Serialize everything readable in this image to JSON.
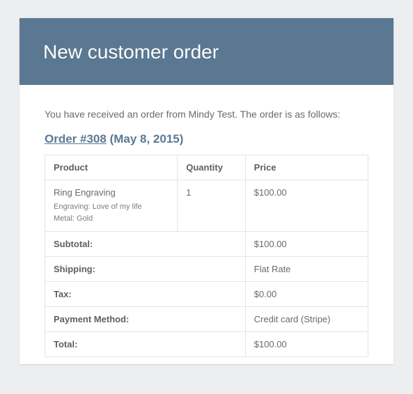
{
  "header": {
    "title": "New customer order"
  },
  "intro": "You have received an order from Mindy Test. The order is as follows:",
  "order": {
    "link_text": "Order #308",
    "date_text": "(May 8, 2015)"
  },
  "columns": {
    "product": "Product",
    "quantity": "Quantity",
    "price": "Price"
  },
  "items": [
    {
      "name": "Ring Engraving",
      "meta": [
        "Engraving: Love of my life",
        "Metal: Gold"
      ],
      "quantity": "1",
      "price": "$100.00"
    }
  ],
  "totals": [
    {
      "label": "Subtotal:",
      "value": "$100.00"
    },
    {
      "label": "Shipping:",
      "value": "Flat Rate"
    },
    {
      "label": "Tax:",
      "value": "$0.00"
    },
    {
      "label": "Payment Method:",
      "value": "Credit card (Stripe)"
    },
    {
      "label": "Total:",
      "value": "$100.00"
    }
  ]
}
